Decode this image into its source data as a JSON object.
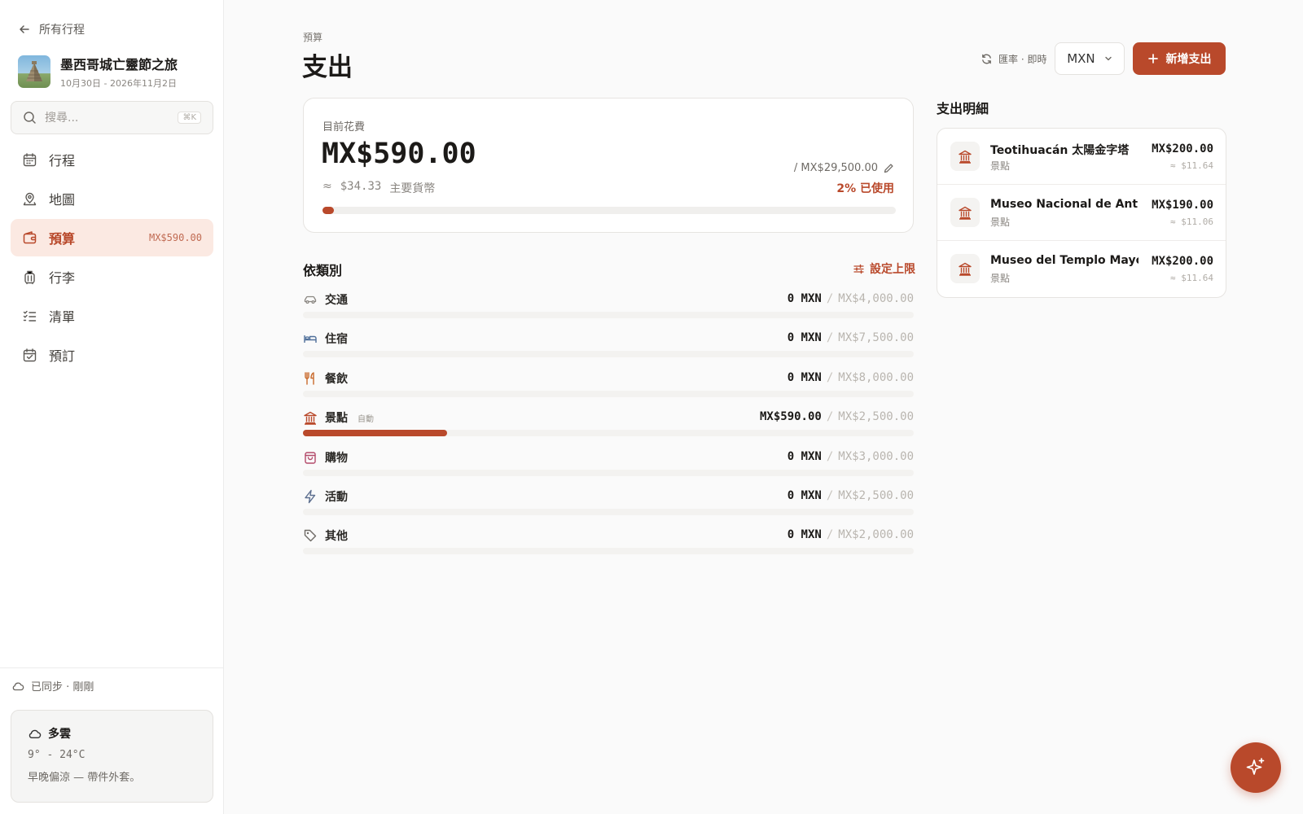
{
  "sidebar": {
    "back_label": "所有行程",
    "trip": {
      "title": "墨西哥城亡靈節之旅",
      "dates": "10月30日  -  2026年11月2日"
    },
    "search": {
      "placeholder": "搜尋...",
      "shortcut": "⌘K"
    },
    "nav": [
      {
        "label": "行程",
        "icon": "calendar-icon"
      },
      {
        "label": "地圖",
        "icon": "map-pin-icon"
      },
      {
        "label": "預算",
        "icon": "wallet-icon",
        "badge": "MX$590.00",
        "active": true
      },
      {
        "label": "行李",
        "icon": "luggage-icon"
      },
      {
        "label": "清單",
        "icon": "checklist-icon"
      },
      {
        "label": "預訂",
        "icon": "calendar-check-icon"
      }
    ],
    "sync_status": "已同步 · 剛剛",
    "weather": {
      "condition": "多雲",
      "temp": "9° - 24°C",
      "note": "早晚偏涼 — 帶件外套。"
    }
  },
  "header": {
    "eyebrow": "預算",
    "title": "支出",
    "rate_label": "匯率 · 即時",
    "currency": "MXN",
    "add_button": "新增支出"
  },
  "summary": {
    "label": "目前花費",
    "amount": "MX$590.00",
    "approx_symbol": "≈",
    "approx_value": "$34.33",
    "approx_note": "主要貨幣",
    "limit": "/ MX$29,500.00",
    "percent_used": "2% 已使用",
    "progress_fraction": 0.02
  },
  "categories": {
    "title": "依類別",
    "set_limit": "設定上限",
    "items": [
      {
        "name": "交通",
        "icon": "car-icon",
        "color": "#8a8681",
        "spent": "0 MXN",
        "limit": "MX$4,000.00",
        "fraction": 0
      },
      {
        "name": "住宿",
        "icon": "bed-icon",
        "color": "#4f6f9a",
        "spent": "0 MXN",
        "limit": "MX$7,500.00",
        "fraction": 0
      },
      {
        "name": "餐飲",
        "icon": "utensils-icon",
        "color": "#c96a2c",
        "spent": "0 MXN",
        "limit": "MX$8,000.00",
        "fraction": 0
      },
      {
        "name": "景點",
        "icon": "landmark-icon",
        "color": "#b9492b",
        "tag": "自動",
        "spent": "MX$590.00",
        "limit": "MX$2,500.00",
        "fraction": 0.236
      },
      {
        "name": "購物",
        "icon": "shopping-bag-icon",
        "color": "#b34a6a",
        "spent": "0 MXN",
        "limit": "MX$3,000.00",
        "fraction": 0
      },
      {
        "name": "活動",
        "icon": "zap-icon",
        "color": "#5d6f8f",
        "spent": "0 MXN",
        "limit": "MX$2,500.00",
        "fraction": 0
      },
      {
        "name": "其他",
        "icon": "tag-icon",
        "color": "#6e6a65",
        "spent": "0 MXN",
        "limit": "MX$2,000.00",
        "fraction": 0
      }
    ]
  },
  "details": {
    "title": "支出明細",
    "items": [
      {
        "name": "Teotihuacán 太陽金字塔",
        "category": "景點",
        "amount": "MX$200.00",
        "converted": "≈ $11.64"
      },
      {
        "name": "Museo Nacional de Antropología",
        "category": "景點",
        "amount": "MX$190.00",
        "converted": "≈ $11.06"
      },
      {
        "name": "Museo del Templo Mayor",
        "category": "景點",
        "amount": "MX$200.00",
        "converted": "≈ $11.64"
      }
    ]
  },
  "colors": {
    "accent": "#b9492b",
    "accent_soft": "#fbe9e2"
  }
}
